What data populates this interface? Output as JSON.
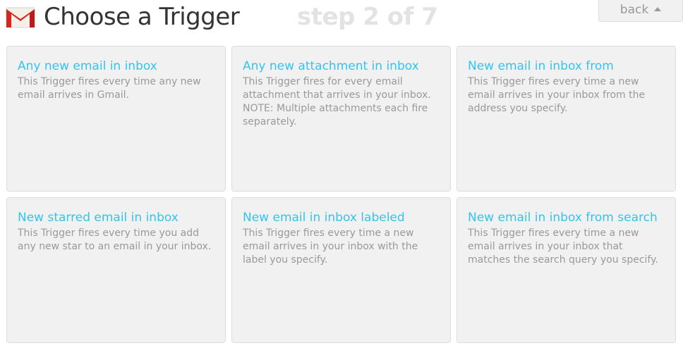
{
  "header": {
    "title": "Choose a Trigger",
    "step": "step 2 of 7",
    "back_label": "back",
    "icon": "gmail-icon"
  },
  "colors": {
    "title": "#333333",
    "step": "#e3e3e3",
    "card_title": "#33c4ee",
    "card_desc": "#999999",
    "card_bg": "#f1f1f1"
  },
  "triggers": [
    {
      "title": "Any new email in inbox",
      "description": "This Trigger fires every time any new email arrives in Gmail."
    },
    {
      "title": "Any new attachment in inbox",
      "description": "This Trigger fires for every email attachment that arrives in your inbox. NOTE: Multiple attachments each fire separately."
    },
    {
      "title": "New email in inbox from",
      "description": "This Trigger fires every time a new email arrives in your inbox from the address you specify."
    },
    {
      "title": "New starred email in inbox",
      "description": "This Trigger fires every time you add any new star to an email in your inbox."
    },
    {
      "title": "New email in inbox labeled",
      "description": "This Trigger fires every time a new email arrives in your inbox with the label you specify."
    },
    {
      "title": "New email in inbox from search",
      "description": "This Trigger fires every time a new email arrives in your inbox that matches the search query you specify."
    }
  ]
}
